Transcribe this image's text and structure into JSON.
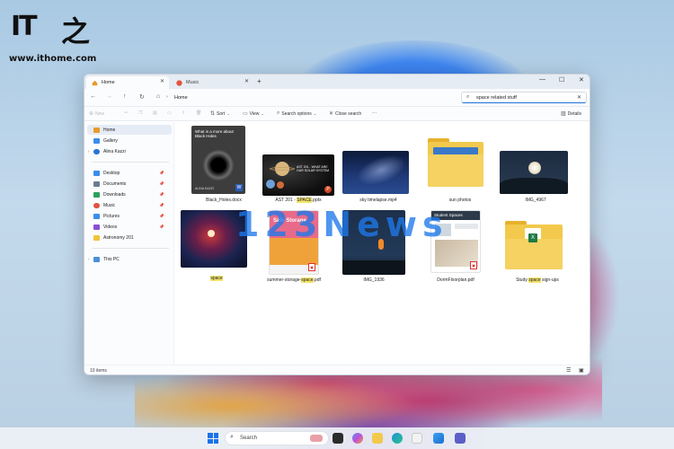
{
  "site": {
    "logo_text": "IT之家",
    "url": "www.ithome.com"
  },
  "watermark": "123News",
  "tabs": [
    {
      "label": "Home",
      "active": true
    },
    {
      "label": "Music",
      "active": false
    }
  ],
  "address": {
    "path": "Home",
    "search_value": "space related stuff"
  },
  "toolbar": {
    "new": "New",
    "sort": "Sort",
    "view": "View",
    "search_options": "Search options",
    "close_search": "Close search",
    "more": "···",
    "details": "Details"
  },
  "sidebar": {
    "top": [
      {
        "label": "Home",
        "icon": "home-icon",
        "color": "#e89a2b"
      },
      {
        "label": "Gallery",
        "icon": "gallery-icon",
        "color": "#3a8ee8"
      },
      {
        "label": "Alina Kazzi",
        "icon": "onedrive-icon",
        "color": "#2a73d9"
      }
    ],
    "pinned": [
      {
        "label": "Desktop",
        "icon": "desktop-icon",
        "color": "#3a8ee8"
      },
      {
        "label": "Documents",
        "icon": "documents-icon",
        "color": "#6b7c93"
      },
      {
        "label": "Downloads",
        "icon": "downloads-icon",
        "color": "#2aa05b"
      },
      {
        "label": "Music",
        "icon": "music-icon",
        "color": "#e0533f"
      },
      {
        "label": "Pictures",
        "icon": "pictures-icon",
        "color": "#3a8ee8"
      },
      {
        "label": "Videos",
        "icon": "videos-icon",
        "color": "#8a4fd1"
      },
      {
        "label": "Astronomy 201",
        "icon": "folder-icon",
        "color": "#f0c43c"
      }
    ],
    "this_pc": "This PC"
  },
  "files": [
    {
      "name": "Black_Holes.docx",
      "kind": "doc-blackhole",
      "thumb_title": "What is a more about Black Holes",
      "thumb_author": "ALINA KAZZI"
    },
    {
      "name_pre": "AST 201 - ",
      "name_hl": "SPACE",
      "name_post": ".pptx",
      "kind": "planets",
      "thumb_title": "AST 201 - WHAT ARE OUR SOLAR SYSTEM"
    },
    {
      "name": "sky timelapse.mp4",
      "kind": "night-sky"
    },
    {
      "name": "sun photos",
      "kind": "folder"
    },
    {
      "name": "IMG_4967",
      "kind": "moon"
    },
    {
      "name_hl": "space",
      "kind": "nebula"
    },
    {
      "name_pre": "summer-storage-",
      "name_hl": "space",
      "name_post": ".pdf",
      "kind": "storage",
      "thumb_title": "Safe Storage"
    },
    {
      "name": "IMG_1936",
      "kind": "rocket"
    },
    {
      "name": "DormFloorplan.pdf",
      "kind": "dorm",
      "thumb_title": "Student Spaces"
    },
    {
      "name_pre": "Study ",
      "name_hl": "space",
      "name_post": " sign-ups",
      "kind": "excel-folder"
    }
  ],
  "status": {
    "count": "10 items"
  },
  "taskbar": {
    "search_placeholder": "Search"
  }
}
